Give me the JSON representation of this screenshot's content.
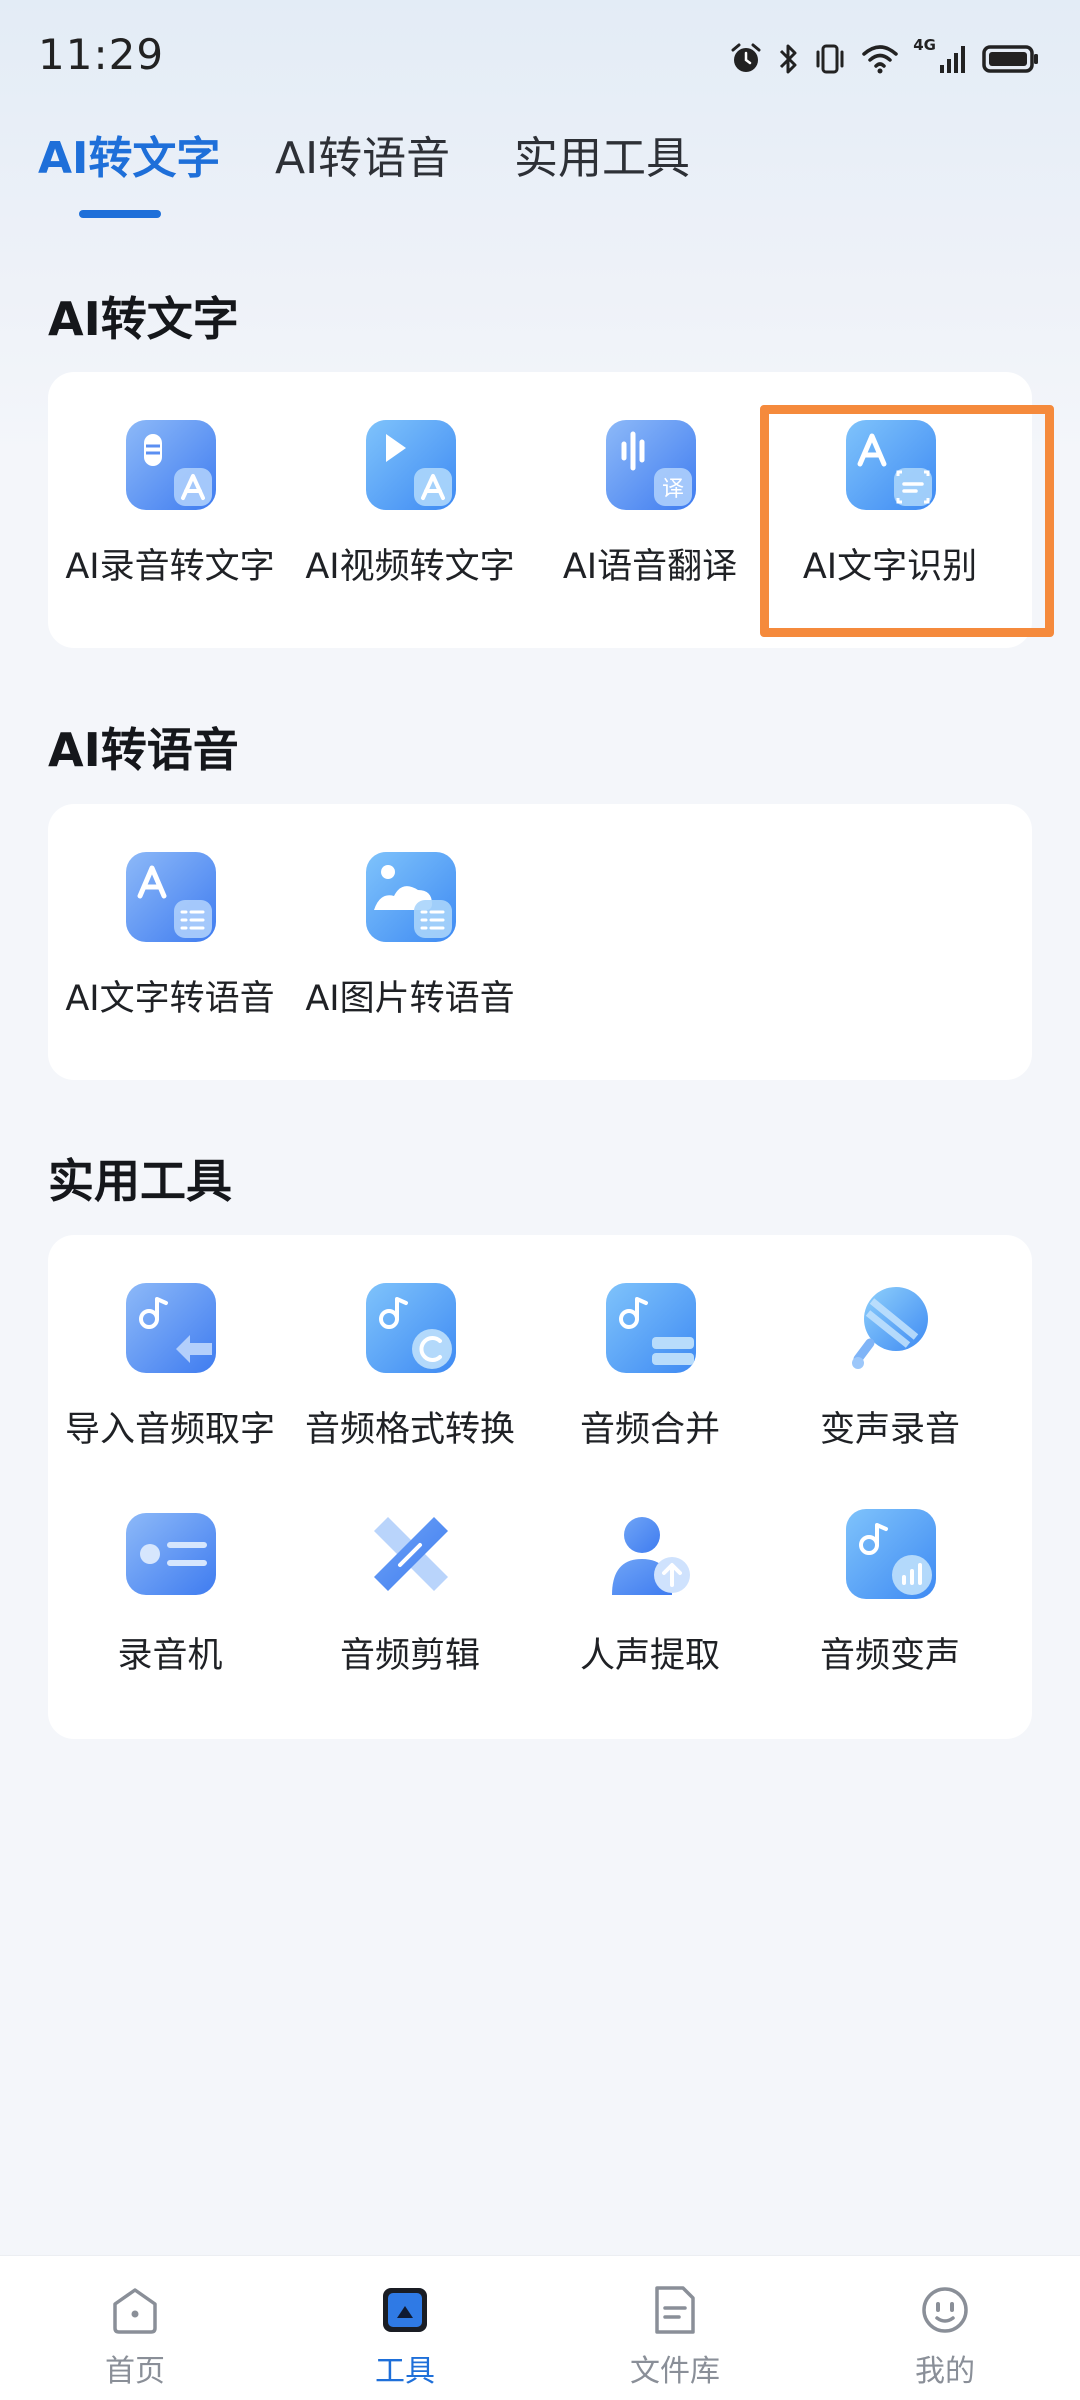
{
  "status_bar": {
    "time": "11:29",
    "network": "4G",
    "icons": [
      "alarm-icon",
      "bluetooth-icon",
      "vibrate-icon",
      "wifi-icon",
      "signal-icon",
      "battery-icon"
    ]
  },
  "tabs": [
    {
      "label": "AI转文字",
      "active": true
    },
    {
      "label": "AI转语音",
      "active": false
    },
    {
      "label": "实用工具",
      "active": false
    }
  ],
  "sections": {
    "ai_to_text": {
      "title": "AI转文字",
      "items": [
        {
          "label": "AI录音转文字",
          "icon": "mic-to-text-icon"
        },
        {
          "label": "AI视频转文字",
          "icon": "video-to-text-icon"
        },
        {
          "label": "AI语音翻译",
          "icon": "voice-translate-icon",
          "badge": "译"
        },
        {
          "label": "AI文字识别",
          "icon": "text-recognition-icon",
          "highlighted": true
        }
      ]
    },
    "ai_to_speech": {
      "title": "AI转语音",
      "items": [
        {
          "label": "AI文字转语音",
          "icon": "text-to-speech-icon"
        },
        {
          "label": "AI图片转语音",
          "icon": "image-to-speech-icon"
        }
      ]
    },
    "utilities": {
      "title": "实用工具",
      "items": [
        {
          "label": "导入音频取字",
          "icon": "import-audio-icon"
        },
        {
          "label": "音频格式转换",
          "icon": "audio-convert-icon"
        },
        {
          "label": "音频合并",
          "icon": "audio-merge-icon"
        },
        {
          "label": "变声录音",
          "icon": "voice-change-record-icon"
        },
        {
          "label": "录音机",
          "icon": "recorder-icon"
        },
        {
          "label": "音频剪辑",
          "icon": "audio-edit-icon"
        },
        {
          "label": "人声提取",
          "icon": "vocal-extract-icon"
        },
        {
          "label": "音频变声",
          "icon": "audio-voice-change-icon"
        }
      ]
    }
  },
  "bottom_nav": [
    {
      "label": "首页",
      "icon": "home-icon",
      "active": false
    },
    {
      "label": "工具",
      "icon": "tools-icon",
      "active": true
    },
    {
      "label": "文件库",
      "icon": "file-library-icon",
      "active": false
    },
    {
      "label": "我的",
      "icon": "profile-icon",
      "active": false
    }
  ],
  "colors": {
    "accent": "#1e6fd9",
    "highlight": "#f58a3c",
    "icon_gradient_start": "#7fb4f7",
    "icon_gradient_end": "#3f7cf0"
  }
}
